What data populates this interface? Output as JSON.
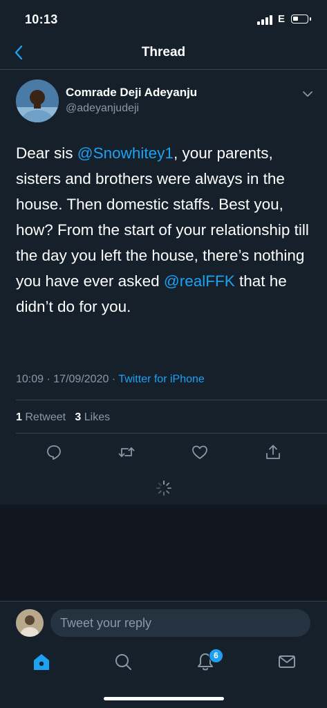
{
  "status_bar": {
    "time": "10:13",
    "network": "E"
  },
  "header": {
    "title": "Thread"
  },
  "tweet": {
    "author_name": "Comrade Deji Adeyanju",
    "author_handle": "@adeyanjudeji",
    "text_parts": [
      {
        "text": "Dear sis "
      },
      {
        "text": "@Snowhitey1",
        "mention": true
      },
      {
        "text": ", your parents, sisters and brothers were always in the house. Then domestic staffs. Best you, how? From the start of your relationship till the day you left the house, there’s nothing you have ever asked "
      },
      {
        "text": "@realFFK",
        "mention": true
      },
      {
        "text": " that he didn’t do for you."
      }
    ],
    "time": "10:09",
    "date": "17/09/2020",
    "separator": "·",
    "source": "Twitter for iPhone",
    "retweet_count": "1",
    "retweet_label": "Retweet",
    "like_count": "3",
    "like_label": "Likes"
  },
  "reply": {
    "placeholder": "Tweet your reply"
  },
  "tabbar": {
    "notification_badge": "6"
  },
  "colors": {
    "background": "#15202b",
    "accent": "#1da1f2",
    "secondary_text": "#8899a6",
    "divider": "#38444d"
  },
  "icons": [
    "back-chevron-icon",
    "caret-down-icon",
    "reply-icon",
    "retweet-icon",
    "like-icon",
    "share-icon",
    "loading-spinner-icon",
    "home-icon",
    "search-icon",
    "notifications-icon",
    "messages-icon"
  ]
}
